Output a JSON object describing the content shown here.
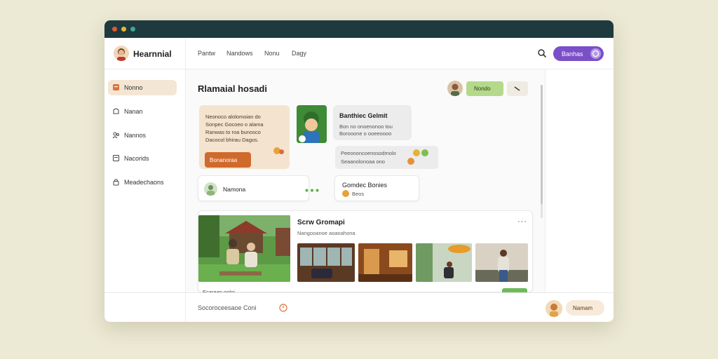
{
  "app": {
    "name": "Hearnnial"
  },
  "header": {
    "nav": [
      "Pantw",
      "Nandows",
      "Nonu",
      "Dagy"
    ],
    "cta_label": "Banhas"
  },
  "sidebar": {
    "items": [
      {
        "label": "Nonno",
        "icon": "home-icon",
        "active": true
      },
      {
        "label": "Nanan",
        "icon": "bell-icon",
        "active": false
      },
      {
        "label": "Nannos",
        "icon": "users-icon",
        "active": false
      },
      {
        "label": "Nacorids",
        "icon": "document-icon",
        "active": false
      },
      {
        "label": "Meadechaons",
        "icon": "lock-icon",
        "active": false
      }
    ]
  },
  "main": {
    "title": "Rlamaial hosadi",
    "action_label": "Nondo",
    "message": {
      "lines": [
        "Neonoco alolomoian do",
        "Sonpec Gocoeo o alama",
        "Ranwas to roa bunosco",
        "Dacocol bhirau Dagos."
      ],
      "button": "Bonanoraa"
    },
    "info_card": {
      "title": "Banthiec Gelmit",
      "lines": [
        "Bon no onoenonoo tou",
        "Borooone o ooeeoooo"
      ]
    },
    "reply": {
      "lines": [
        "Peeononcoenosodmolo",
        "Seaanolonoaa ono"
      ]
    },
    "person": {
      "name": "Namona"
    },
    "status": {
      "title": "Gomdec Bonies",
      "sub": "Beos"
    },
    "feed": {
      "title": "Scrw Gromapi",
      "subtitle": "Nangooanoe aoaoahona",
      "caption": "Ecaraan ooloi"
    }
  },
  "footer": {
    "composer": "Socoroceesaoe Coni",
    "button": "Namam"
  },
  "colors": {
    "titlebar": "#1e3a3f",
    "accent_purple": "#7a4fc8",
    "accent_orange": "#d06a2c",
    "accent_green": "#b5d98a",
    "sidebar_active": "#f4e6d4"
  }
}
